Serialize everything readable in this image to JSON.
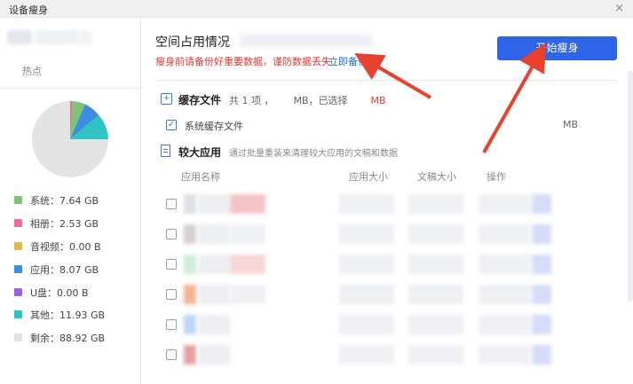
{
  "window": {
    "title": "设备瘦身",
    "close_glyph": "×"
  },
  "sidebar": {
    "hot_label": "热点",
    "legend": [
      {
        "label": "系统：7.64 GB",
        "color": "#7cc576"
      },
      {
        "label": "相册：2.53 GB",
        "color": "#e86ca0"
      },
      {
        "label": "音视频：0.00 B",
        "color": "#e0b94b"
      },
      {
        "label": "应用：8.07 GB",
        "color": "#3d8de0"
      },
      {
        "label": "U盘：0.00 B",
        "color": "#9b63e0"
      },
      {
        "label": "其他：11.93 GB",
        "color": "#2ec4c4"
      },
      {
        "label": "剩余：88.92 GB",
        "color": "#e2e2e2"
      }
    ]
  },
  "main": {
    "title": "空间占用情况",
    "warning": "瘦身前请备份好重要数据，谨防数据丢失",
    "backup_link": "立即备份",
    "start_button": "开始瘦身",
    "cache": {
      "title": "缓存文件",
      "info_prefix": "共 1 项 ，",
      "info_mid": "MB，已选择",
      "info_red": "MB",
      "item_label": "系统缓存文件",
      "item_size": "MB"
    },
    "large_apps": {
      "title": "较大应用",
      "description": "通过批量重装来清理较大应用的文稿和数据",
      "columns": [
        "应用名称",
        "应用大小",
        "文稿大小",
        "操作"
      ]
    }
  },
  "colors": {
    "accent": "#2f64e8",
    "warning": "#e53935",
    "link": "#1e6ce8",
    "annotation_arrow": "#e8412f"
  },
  "icons": [
    "close-icon",
    "cache-icon",
    "checkbox-icon",
    "document-icon",
    "pie-chart"
  ]
}
